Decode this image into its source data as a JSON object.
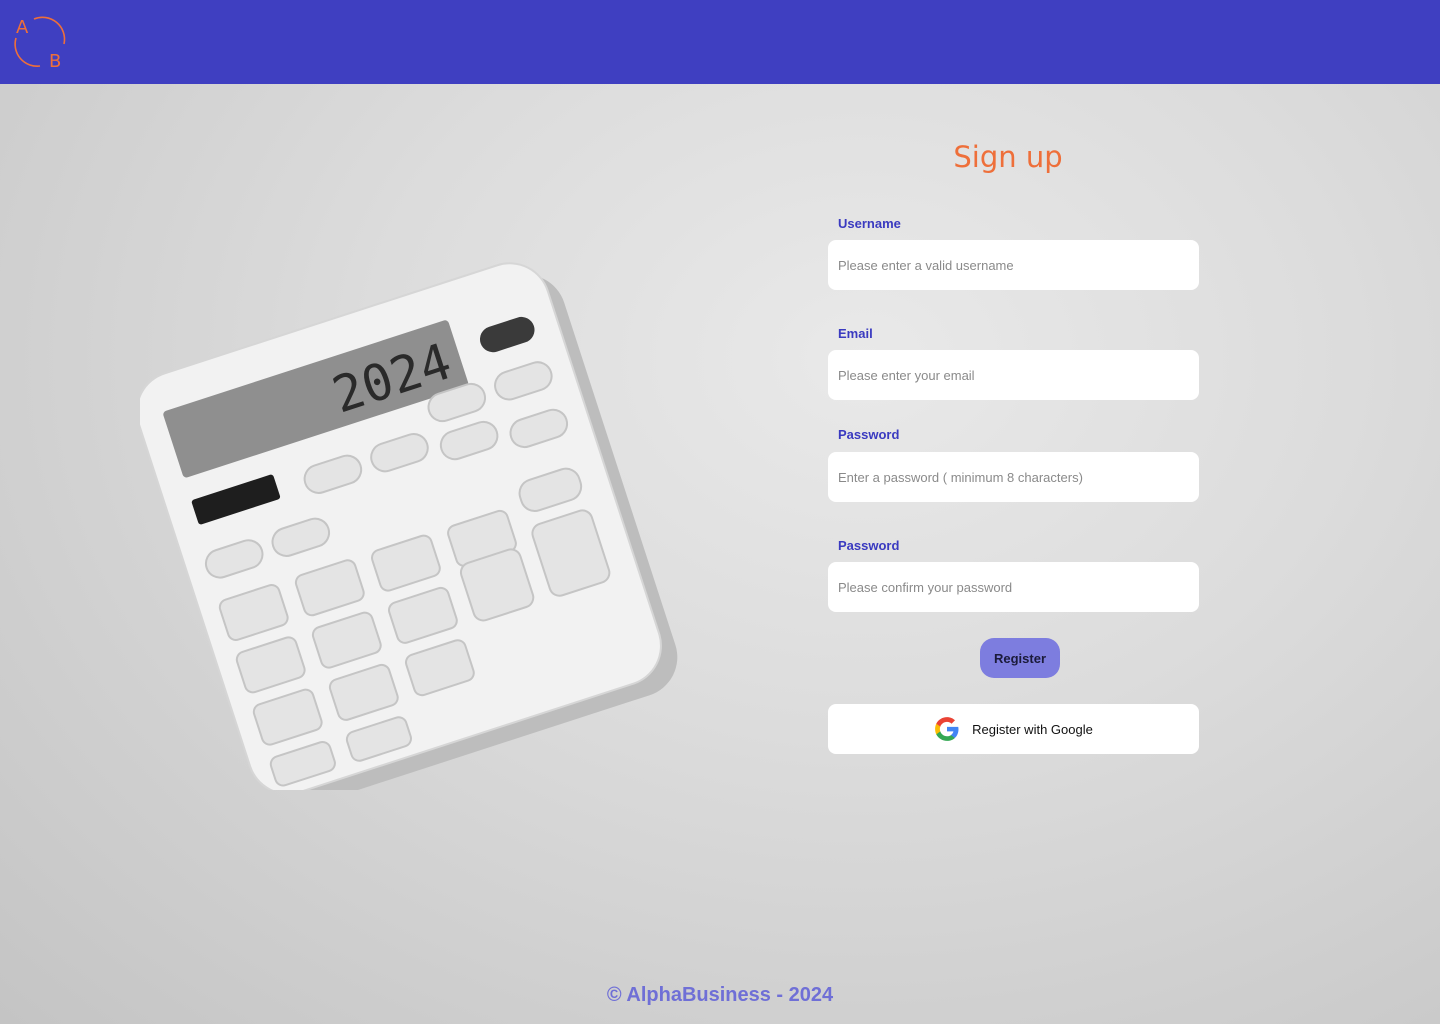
{
  "header": {
    "logo_letter_a": "A",
    "logo_letter_b": "B",
    "logo_icon": "ab-logo-icon"
  },
  "illustration": {
    "icon": "calculator-illustration",
    "display": "2024"
  },
  "form": {
    "title": "Sign up",
    "username": {
      "label": "Username",
      "placeholder": "Please enter a valid username"
    },
    "email": {
      "label": "Email",
      "placeholder": "Please enter your email"
    },
    "password": {
      "label": "Password",
      "placeholder": "Enter a password ( minimum 8 characters)"
    },
    "confirm": {
      "label": "Password",
      "placeholder": "Please confirm your password"
    },
    "register_label": "Register",
    "google_label": "Register with Google",
    "google_icon": "google-icon"
  },
  "footer": {
    "text": "© AlphaBusiness - 2024"
  },
  "colors": {
    "header_bg": "#3f3fc1",
    "accent": "#ee6f3a",
    "label": "#3a3ac0",
    "button": "#7d7ddf"
  }
}
